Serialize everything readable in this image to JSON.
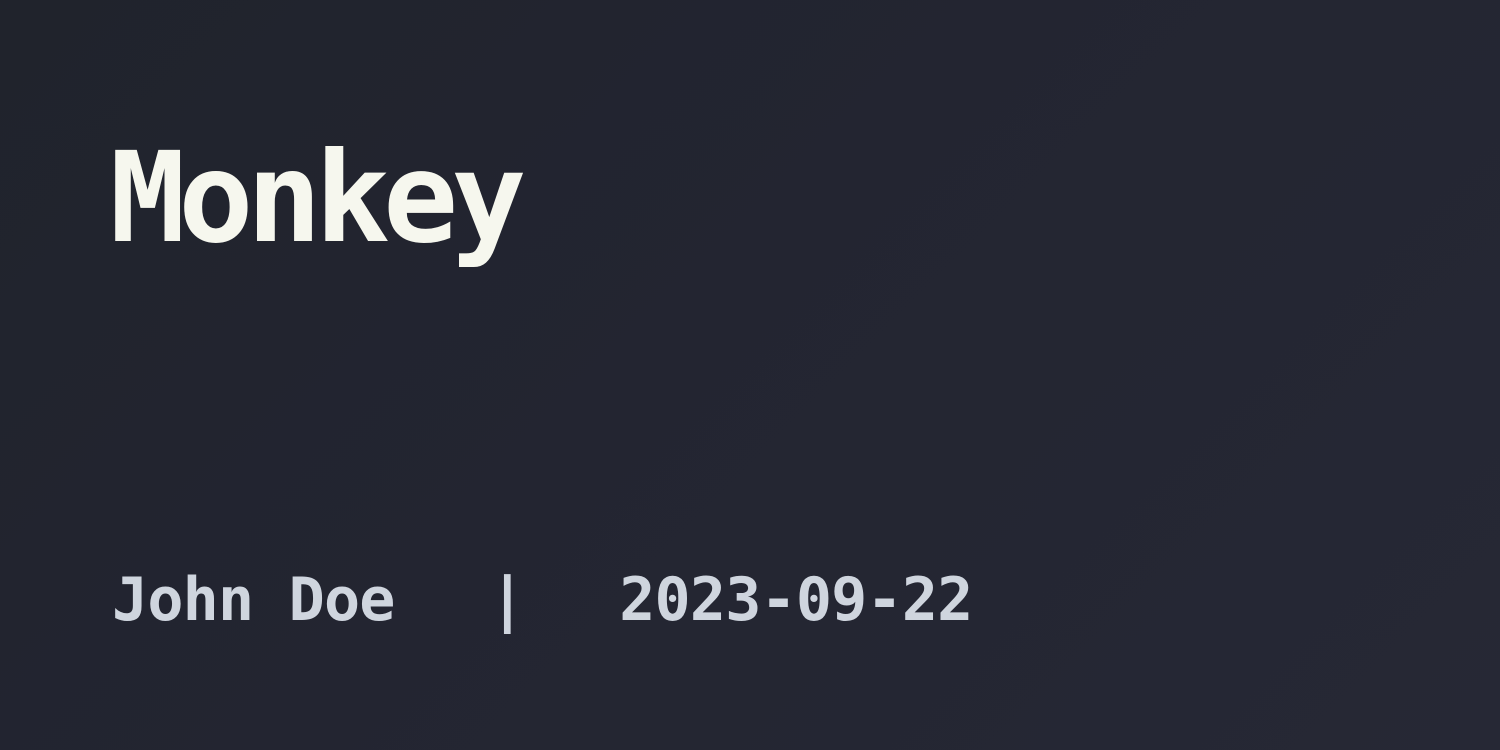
{
  "post": {
    "title": "Monkey",
    "author": "John Doe",
    "separator": "|",
    "date": "2023-09-22"
  }
}
